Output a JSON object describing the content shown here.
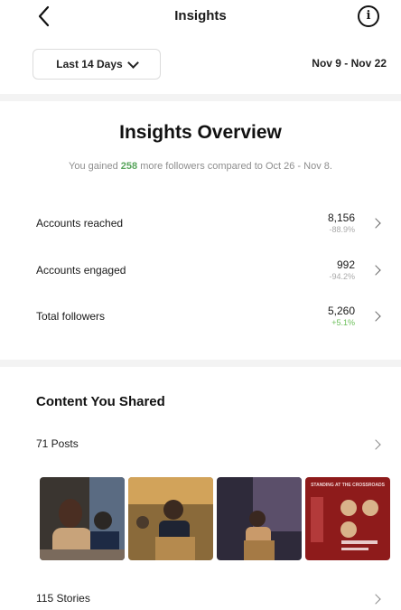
{
  "header": {
    "title": "Insights",
    "info_label": "i"
  },
  "filter": {
    "range_label": "Last 14 Days",
    "date_range": "Nov 9 - Nov 22"
  },
  "overview": {
    "title": "Insights Overview",
    "gain_prefix": "You gained",
    "gain_value": "258",
    "gain_suffix": "more followers compared to Oct 26 - Nov 8."
  },
  "metrics": [
    {
      "label": "Accounts reached",
      "value": "8,156",
      "change": "-88.9%",
      "positive": false
    },
    {
      "label": "Accounts engaged",
      "value": "992",
      "change": "-94.2%",
      "positive": false
    },
    {
      "label": "Total followers",
      "value": "5,260",
      "change": "+5.1%",
      "positive": true
    }
  ],
  "content": {
    "title": "Content You Shared",
    "posts_label": "71 Posts",
    "stories_label": "115 Stories",
    "thumb_caption": "STANDING AT THE CROSSROADS"
  },
  "colors": {
    "accent_green": "#58a55c",
    "divider": "#f3f3f3",
    "poster_red": "#8e1b1b"
  }
}
